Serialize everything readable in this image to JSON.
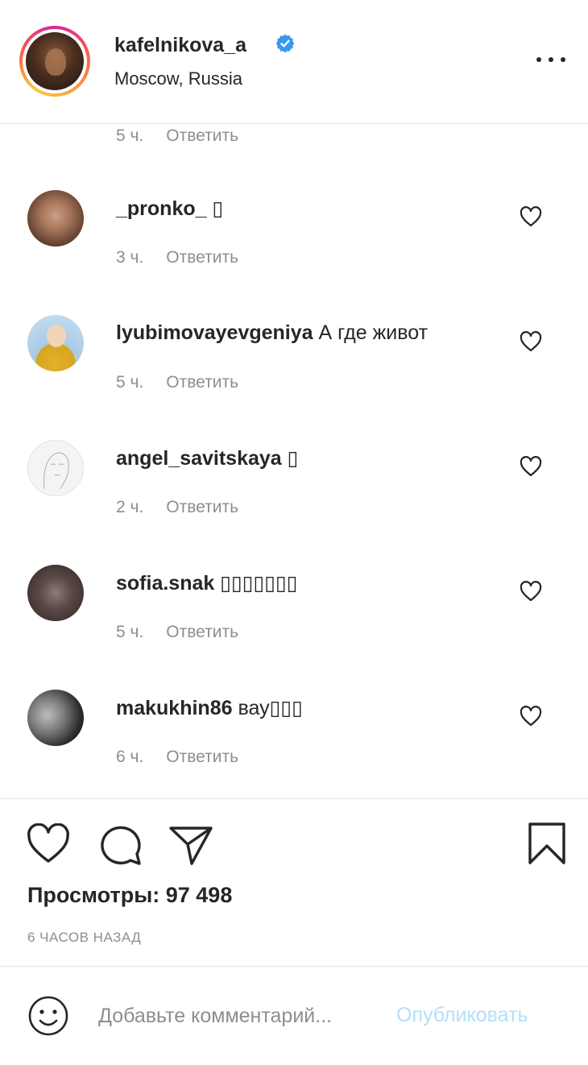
{
  "header": {
    "username": "kafelnikova_a",
    "location": "Moscow, Russia",
    "verified_icon": "verified-badge-icon",
    "more_icon": "more-options-icon"
  },
  "previous_comment": {
    "time": "5 ч.",
    "reply_label": "Ответить"
  },
  "comments": [
    {
      "author": "_pronko_",
      "text": "▯",
      "time": "3 ч.",
      "reply_label": "Ответить"
    },
    {
      "author": "lyubimovayevgeniya",
      "text": "А где живот",
      "time": "5 ч.",
      "reply_label": "Ответить"
    },
    {
      "author": "angel_savitskaya",
      "text": "▯",
      "time": "2 ч.",
      "reply_label": "Ответить"
    },
    {
      "author": "sofia.snak",
      "text": "▯▯▯▯▯▯▯",
      "time": "5 ч.",
      "reply_label": "Ответить"
    },
    {
      "author": "makukhin86",
      "text": "вау▯▯▯",
      "time": "6 ч.",
      "reply_label": "Ответить"
    }
  ],
  "footer": {
    "views": "Просмотры: 97 498",
    "posted_time": "6 ЧАСОВ НАЗАД"
  },
  "comment_box": {
    "placeholder": "Добавьте комментарий...",
    "publish_label": "Опубликовать"
  },
  "colors": {
    "text": "#262626",
    "secondary": "#8e8e8e",
    "verified": "#3897f0",
    "publish_disabled": "#b2dffc"
  }
}
